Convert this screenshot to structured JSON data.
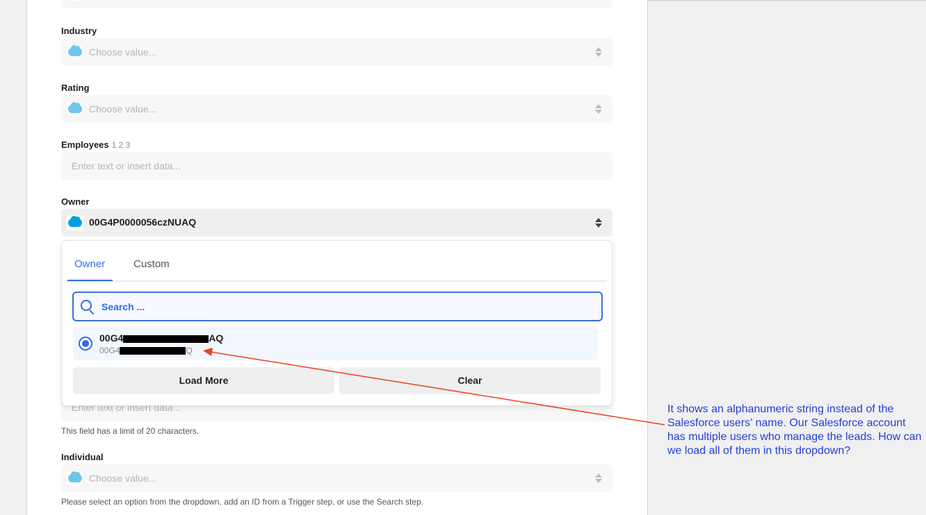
{
  "fields": {
    "industry": {
      "label": "Industry",
      "placeholder": "Choose value..."
    },
    "rating": {
      "label": "Rating",
      "placeholder": "Choose value..."
    },
    "employees": {
      "label": "Employees",
      "hint": "1 2 3",
      "placeholder": "Enter text or insert data..."
    },
    "owner": {
      "label": "Owner",
      "value": "00G4P0000056czNUAQ"
    },
    "hidden_text": {
      "placeholder": "Enter text or insert data...",
      "helper": "This field has a limit of 20 characters."
    },
    "individual": {
      "label": "Individual",
      "placeholder": "Choose value...",
      "helper": "Please select an option from the dropdown, add an ID from a Trigger step, or use the Search step."
    }
  },
  "dropdown": {
    "tabs": [
      "Owner",
      "Custom"
    ],
    "active_tab": "Owner",
    "search_placeholder": "Search ...",
    "option": {
      "title_prefix": "00G4",
      "title_suffix": "AQ",
      "sub_prefix": "00G4",
      "sub_suffix": "Q"
    },
    "load_more_label": "Load More",
    "clear_label": "Clear"
  },
  "annotation": {
    "text": "It shows an alphanumeric string instead of the Salesforce users’ name. Our Salesforce account has multiple users who manage the leads. How can we load all of them in this dropdown?",
    "color": "#2240d6",
    "arrow_color": "#e8401c"
  },
  "colors": {
    "accent": "#2f6ce5",
    "salesforce": "#00a1e0"
  }
}
